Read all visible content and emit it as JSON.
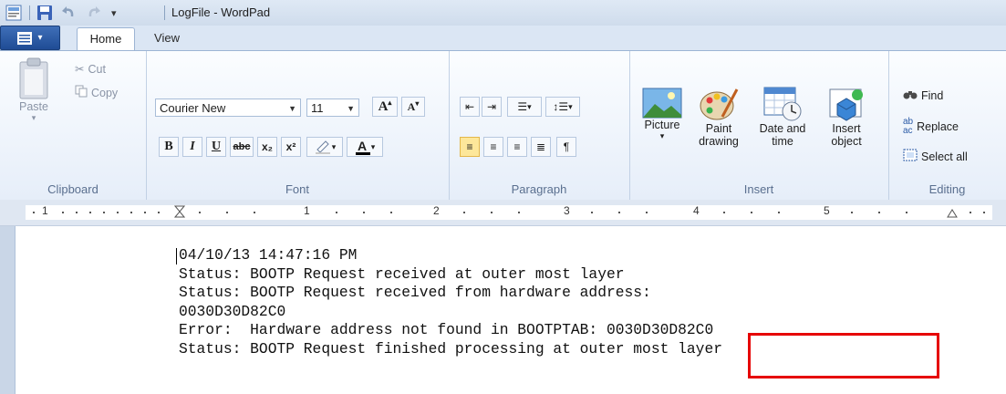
{
  "titlebar": {
    "title": "LogFile - WordPad",
    "qa_icons": [
      "app-icon",
      "save-icon",
      "undo-icon",
      "redo-icon",
      "customize-dropdown-icon"
    ]
  },
  "tabs": {
    "file_menu_icon": "app-menu-icon",
    "home": "Home",
    "view": "View"
  },
  "clipboard": {
    "paste": "Paste",
    "cut": "Cut",
    "copy": "Copy",
    "label": "Clipboard"
  },
  "font": {
    "family": "Courier New",
    "size": "11",
    "grow_icon": "grow-font-icon",
    "shrink_icon": "shrink-font-icon",
    "bold": "B",
    "italic": "I",
    "underline": "U",
    "strike": "abc",
    "subscript": "x₂",
    "superscript": "x²",
    "highlight_icon": "highlighter-icon",
    "color_icon": "font-color-icon",
    "label": "Font"
  },
  "paragraph": {
    "label": "Paragraph"
  },
  "insert": {
    "picture": "Picture",
    "paint_line1": "Paint",
    "paint_line2": "drawing",
    "datetime_line1": "Date and",
    "datetime_line2": "time",
    "object_line1": "Insert",
    "object_line2": "object",
    "label": "Insert"
  },
  "editing": {
    "find": "Find",
    "replace": "Replace",
    "select_all": "Select all",
    "label": "Editing"
  },
  "ruler": {
    "numbers": [
      "1",
      "1",
      "2",
      "3",
      "4",
      "5"
    ]
  },
  "document": {
    "lines": [
      "04/10/13 14:47:16 PM",
      "Status: BOOTP Request received at outer most layer",
      "Status: BOOTP Request received from hardware address:",
      "0030D30D82C0",
      "Error:  Hardware address not found in BOOTPTAB: 0030D30D82C0",
      "Status: BOOTP Request finished processing at outer most layer"
    ]
  },
  "colors": {
    "highlight_box": "#e60000",
    "file_menu": "#2a5aa6",
    "active_align": "#fde79a"
  }
}
